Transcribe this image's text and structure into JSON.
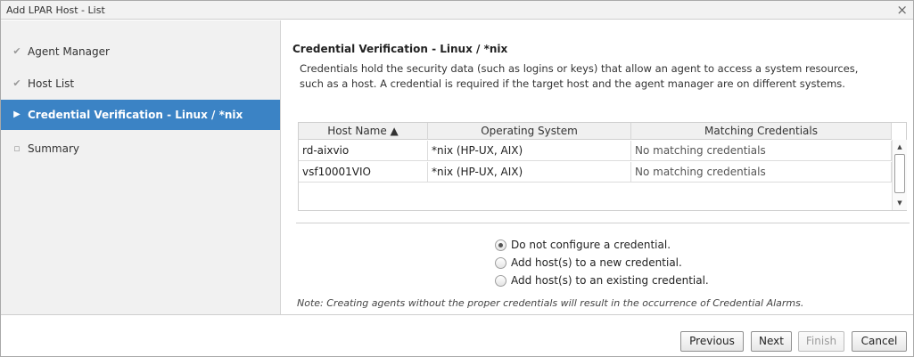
{
  "window": {
    "title": "Add LPAR Host - List",
    "close_glyph": "×"
  },
  "steps": [
    {
      "label": "Agent Manager",
      "icon": "checkmark-icon",
      "glyph": "✔",
      "state": "done"
    },
    {
      "label": "Host List",
      "icon": "checkmark-icon",
      "glyph": "✔",
      "state": "done"
    },
    {
      "label": "Credential Verification - Linux / *nix",
      "icon": "arrow-right-icon",
      "glyph": "▶",
      "state": "active"
    },
    {
      "label": "Summary",
      "icon": "bullet-icon",
      "glyph": "▫",
      "state": "pending"
    }
  ],
  "main": {
    "heading": "Credential Verification - Linux / *nix",
    "description_line1": "Credentials hold the security data (such as logins or keys) that allow an agent to access a system resources,",
    "description_line2": "such as a host. A credential is required if the target host and the agent manager are on different systems."
  },
  "table": {
    "columns": [
      "Host Name ▲",
      "Operating System",
      "Matching Credentials"
    ],
    "rows": [
      [
        "rd-aixvio",
        "*nix (HP-UX, AIX)",
        "No matching credentials"
      ],
      [
        "vsf10001VIO",
        "*nix (HP-UX, AIX)",
        "No matching credentials"
      ]
    ],
    "scroll_up_glyph": "▲",
    "scroll_down_glyph": "▼"
  },
  "options": {
    "selected_index": 0,
    "items": [
      "Do not configure a credential.",
      "Add host(s) to a new credential.",
      "Add host(s) to an existing credential."
    ]
  },
  "note": "Note: Creating agents without the proper credentials will result in the occurrence of Credential Alarms.",
  "buttons": {
    "previous": "Previous",
    "next": "Next",
    "finish": "Finish",
    "cancel": "Cancel"
  },
  "colors": {
    "active_step_bg": "#3b83c5",
    "sidebar_bg": "#f1f1f1"
  }
}
